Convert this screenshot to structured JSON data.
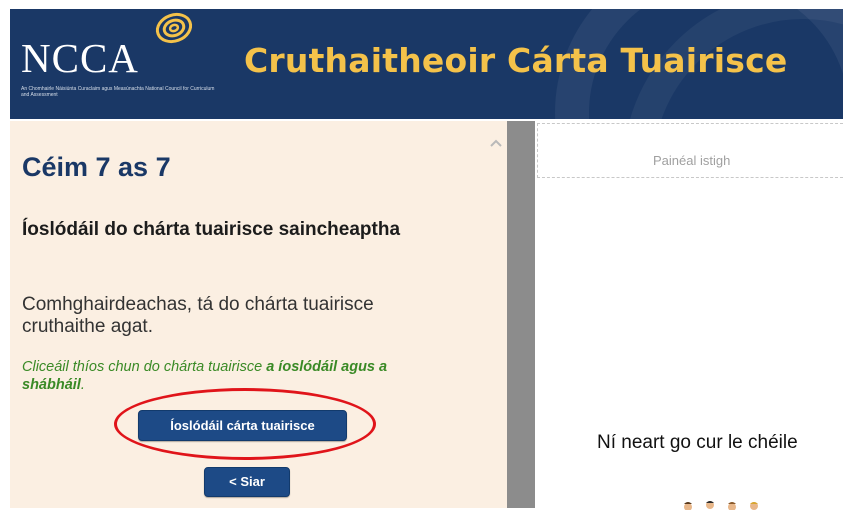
{
  "header": {
    "logo_text": "NCCA",
    "logo_subtitle": "An Chomhairle Náisiúnta Curaclaim agus Measúnachta National Council for Curriculum and Assessment",
    "app_title": "Cruthaitheoir Cárta Tuairisce",
    "colors": {
      "background": "#1a3866",
      "title": "#f4c24a"
    }
  },
  "wizard": {
    "step_title": "Céim 7 as 7",
    "section_heading": "Íoslódáil do chárta tuairisce saincheaptha",
    "body_text": "Comhghairdeachas, tá do chárta tuairisce cruthaithe agat.",
    "hint": {
      "prefix": "Cliceáil thíos chun do chárta tuairisce ",
      "bold": "a íoslódáil agus a shábháil",
      "suffix": "."
    },
    "download_button": "Íoslódáil cárta tuairisce",
    "back_button": "< Siar"
  },
  "preview": {
    "inner_panel_label": "Painéal istigh",
    "motto": "Ní neart go cur le chéile"
  },
  "colors": {
    "panel_bg": "#fbefe2",
    "button_bg": "#1d4a86",
    "hint_green": "#3a8a26",
    "highlight_red": "#e0141a"
  }
}
